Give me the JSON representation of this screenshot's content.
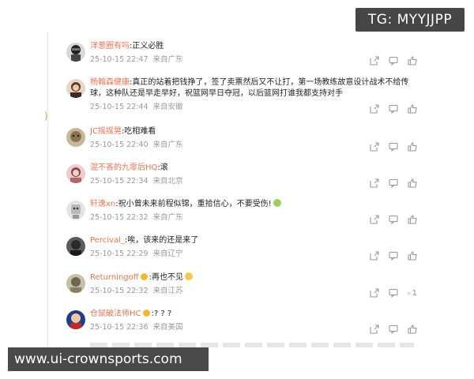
{
  "overlay": {
    "tg_handle": "TG: MYYJJPP",
    "watermark": "www.ui-crownsports.com"
  },
  "comments": [
    {
      "user": "洋葱圈有吗",
      "text": ":正义必胜",
      "date": "25-10-15 22:47",
      "location": "来自广东",
      "likes": ""
    },
    {
      "user": "杨翰森健康",
      "text": ":真正的站着把钱挣了，签了卖票然后又不让打，第一场教练故意设计战术不给传球，这种队还是早走早好，祝篮网早日夺冠，以后篮网打谁我都支持对手",
      "date": "25-10-15 22:44",
      "location": "来自安徽",
      "likes": ""
    },
    {
      "user": "JC摇摇晃",
      "text": ":吃相难看",
      "date": "25-10-15 22:40",
      "location": "来自广东",
      "likes": ""
    },
    {
      "user": "混不吝的九零后HQ",
      "text": ":滚",
      "date": "25-10-15 22:34",
      "location": "来自北京",
      "likes": ""
    },
    {
      "user": "轩逸xn",
      "text": ":祝小曾未来前程似锦，重拾信心，不要受伤!",
      "date": "25-10-15 22:32",
      "location": "来自广东",
      "likes": ""
    },
    {
      "user": "Percival_",
      "text": ":唉，该来的还是来了",
      "date": "25-10-15 22:29",
      "location": "来自辽宁",
      "likes": ""
    },
    {
      "user": "Returningoff",
      "text": ":再也不见",
      "date": "25-10-15 22:32",
      "location": "来自江苏",
      "likes": "1"
    },
    {
      "user": "仓鼠破法师HC",
      "text": ":? ? ?",
      "date": "25-10-15 22:36",
      "location": "来自美国",
      "likes": ""
    }
  ],
  "icons": {
    "share": "share-icon",
    "reply": "comment-icon",
    "like": "thumbs-up-icon"
  },
  "colors": {
    "username": "#eb7350",
    "meta": "#999999",
    "text": "#222222"
  }
}
